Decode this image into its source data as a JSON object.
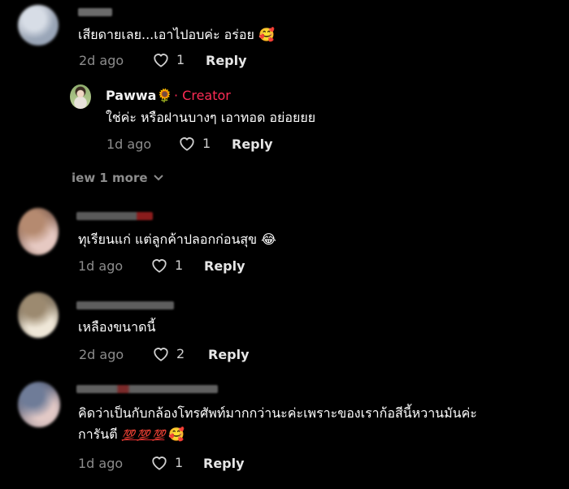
{
  "comments": [
    {
      "text": "เสียดายเลย...เอาไปอบค่ะ อร่อย 🥰",
      "time": "2d ago",
      "likes": "1",
      "reply_label": "Reply"
    },
    {
      "creator_name": "Pawwa🌻",
      "creator_badge": "· Creator",
      "text": "ใช่ค่ะ หรือฝานบางๆ เอาทอด อย่อยยย",
      "time": "1d ago",
      "likes": "1",
      "reply_label": "Reply"
    },
    {
      "view_more": "iew 1 more"
    },
    {
      "text": "ทุเรียนแก่ แต่ลูกค้าปลอกก่อนสุข 😂",
      "time": "1d ago",
      "likes": "1",
      "reply_label": "Reply"
    },
    {
      "text": "เหลืองขนาดนี้",
      "time": "2d ago",
      "likes": "2",
      "reply_label": "Reply"
    },
    {
      "text_line1": "คิดว่าเป็นกับกล้องโทรศัพท์มากกว่านะค่ะเพราะของเราก้อสีนี้หวานมันค่ะ",
      "text_line2_prefix": "การันตี",
      "text_line2_emojis": "💯 💯 💯",
      "text_line2_suffix": "🥰",
      "time": "1d ago",
      "likes": "1",
      "reply_label": "Reply"
    }
  ],
  "colors": {
    "creator_badge": "#fe2c55",
    "meta": "#8c8c8c",
    "background": "#000000"
  },
  "icons": [
    "heart-outline-icon",
    "chevron-down-icon"
  ]
}
